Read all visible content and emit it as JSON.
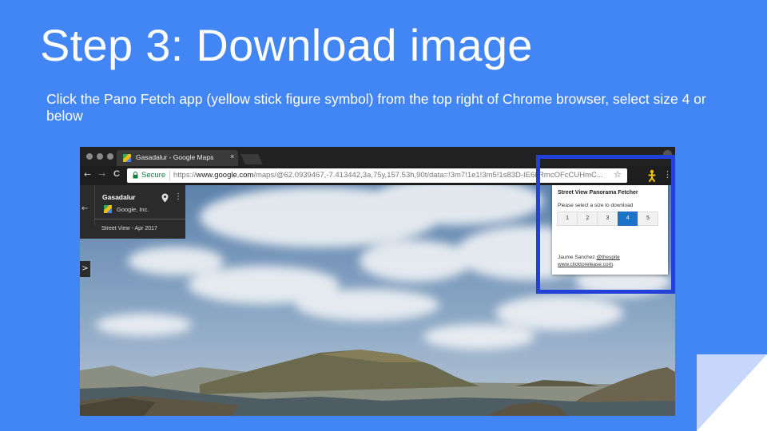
{
  "slide": {
    "title": "Step 3: Download image",
    "instruction": "Click the Pano Fetch app (yellow stick figure symbol) from the top right of Chrome browser, select size 4 or below"
  },
  "browser": {
    "tab_title": "Gasadalur - Google Maps",
    "tab_close": "×",
    "security_label": "Secure",
    "url_scheme": "https://",
    "url_host": "www.google.com",
    "url_path": "/maps/@62.0939467,-7.413442,3a,75y,157.53h,90t/data=!3m7!1e1!3m5!1s83D-IE6kRmcOFcCUHmC...",
    "star_glyph": "☆",
    "kebab_glyph": "⋮",
    "back_glyph": "←",
    "forward_glyph": "→",
    "reload_glyph": "C"
  },
  "maps_card": {
    "place_name": "Gasadalur",
    "brand": "Google, Inc.",
    "date": "Street View - Apr 2017",
    "back_glyph": "←",
    "kebab_glyph": "⋮",
    "expand_glyph": ">"
  },
  "extension_popup": {
    "title": "Street View Panorama Fetcher",
    "prompt": "Please select a size to download",
    "sizes": [
      "1",
      "2",
      "3",
      "4",
      "5"
    ],
    "selected_size": "4",
    "author": "Jaume Sanchez",
    "author_handle": "@thespite",
    "author_site": "www.clicktorelease.com",
    "trailing_period": "."
  },
  "colors": {
    "slide_background": "#4285f4",
    "highlight_border": "#2341d9",
    "selected_size": "#1a73c7",
    "extension_icon": "#f4c20d"
  },
  "icons": [
    "lock-icon",
    "star-icon",
    "pano-fetch-extension-icon",
    "map-pin-icon",
    "google-maps-logo",
    "chrome-sync-icon"
  ]
}
